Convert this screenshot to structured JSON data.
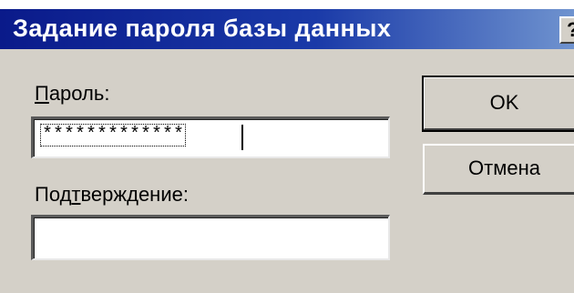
{
  "window": {
    "title": "Задание пароля базы данных",
    "help_glyph": "?"
  },
  "password": {
    "label_mnemonic": "П",
    "label_rest": "ароль:",
    "value": "*************"
  },
  "confirm": {
    "label_before": "Под",
    "label_mnemonic": "т",
    "label_after": "верждение:",
    "value": ""
  },
  "buttons": {
    "ok": "OK",
    "cancel": "Отмена"
  },
  "colors": {
    "titlebar_start": "#0a1a8a",
    "titlebar_end": "#6f93cf",
    "dialog_face": "#d4d0c8"
  },
  "icons": {
    "help": "help-icon"
  }
}
